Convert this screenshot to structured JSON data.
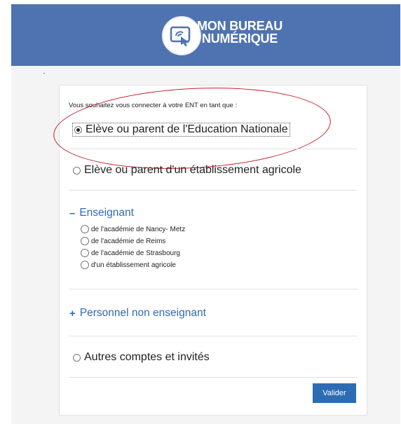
{
  "header": {
    "logo_line1": "MON BUREAU",
    "logo_line2": "NUMÉRIQUE",
    "brand_color": "#4f73b0",
    "icon": "touch-tablet-icon"
  },
  "form": {
    "prompt": "Vous souhaitez vous connecter à votre ENT en tant que :",
    "option_eleve_nationale": "Elève ou parent de l'Education Nationale",
    "option_eleve_agricole": "Elève ou parent d'un établissement agricole",
    "enseignant": {
      "sign": "–",
      "title": "Enseignant",
      "options": [
        "de l'académie de Nancy- Metz",
        "de l'académie de Reims",
        "de l'académie de Strasbourg",
        "d'un établissement agricole"
      ]
    },
    "personnel": {
      "sign": "+",
      "title": "Personnel non enseignant"
    },
    "option_autres": "Autres comptes et invités",
    "validate_label": "Valider",
    "accent_color": "#2d6cb3",
    "annotation_color": "#c21e2b"
  }
}
